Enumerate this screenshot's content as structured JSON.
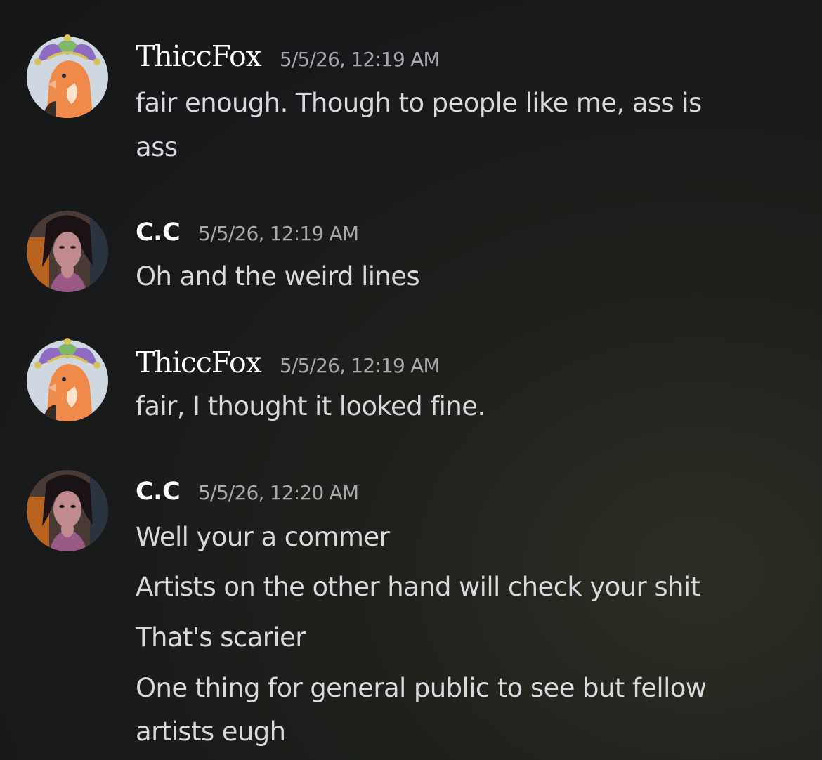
{
  "messages": [
    {
      "author": "ThiccFox",
      "avatar_icon": "jester-fox-avatar",
      "timestamp": "5/5/26, 12:19 AM",
      "lines": [
        "fair enough. Though to people like me, ass is",
        "ass"
      ]
    },
    {
      "author": "C.C",
      "avatar_icon": "dark-haired-woman-avatar",
      "timestamp": "5/5/26, 12:19 AM",
      "lines": [
        "Oh and the weird lines"
      ]
    },
    {
      "author": "ThiccFox",
      "avatar_icon": "jester-fox-avatar",
      "timestamp": "5/5/26, 12:19 AM",
      "lines": [
        "fair, I thought it looked fine."
      ]
    },
    {
      "author": "C.C",
      "avatar_icon": "dark-haired-woman-avatar",
      "timestamp": "5/5/26, 12:20 AM",
      "lines": [
        "Well your a commer",
        "Artists on the other hand will check your shit",
        "That's scarier",
        "One thing for general public to see but fellow",
        "artists eugh"
      ]
    }
  ],
  "colors": {
    "background": "#17191a",
    "username": "#ffffff",
    "timestamp": "#a6a8ae",
    "message_text": "#d8d9dd",
    "fox_orange": "#f08a4b",
    "jester_purple": "#8e6cc4",
    "jester_green": "#7fb86a"
  }
}
